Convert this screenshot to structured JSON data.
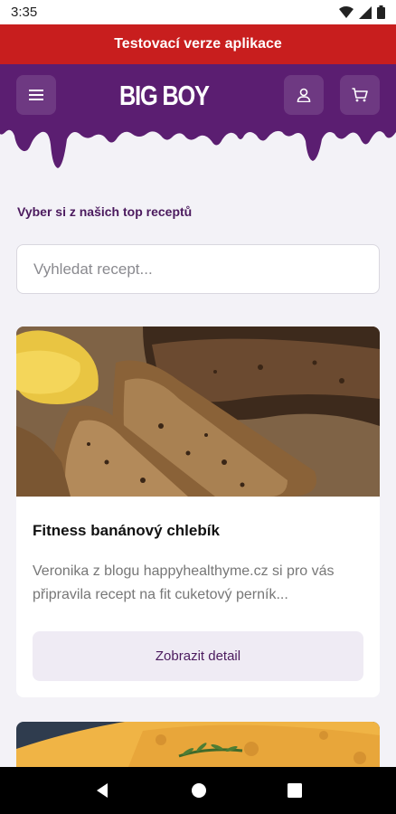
{
  "status": {
    "time": "3:35"
  },
  "banner": {
    "text": "Testovací verze aplikace"
  },
  "header": {
    "logo_text": "BIG BOY"
  },
  "section": {
    "title": "Vyber si z našich top receptů"
  },
  "search": {
    "placeholder": "Vyhledat recept..."
  },
  "recipes": [
    {
      "title": "Fitness banánový chlebík",
      "description": "Veronika z blogu happyhealthyme.cz si pro vás připravila recept na fit cuketový perník...",
      "button_label": "Zobrazit detail",
      "image": "banana-bread-photo"
    },
    {
      "image": "pastry-with-rosemary-photo"
    }
  ],
  "colors": {
    "header": "#5b1e71",
    "banner": "#c81e1e",
    "accent": "#4b1a5e",
    "background": "#f3f2f7"
  }
}
